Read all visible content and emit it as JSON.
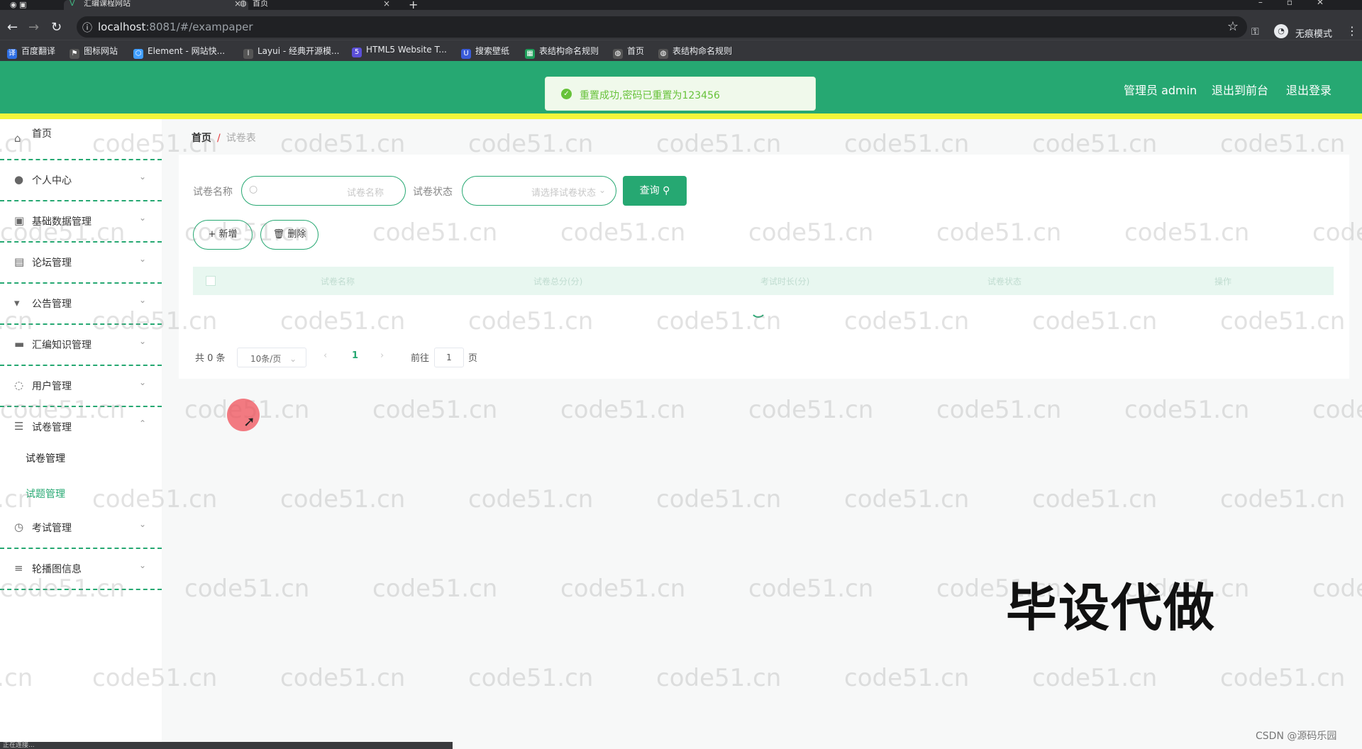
{
  "browser": {
    "tabs": [
      {
        "title": "汇编课程网站",
        "active": true
      },
      {
        "title": "首页",
        "active": false
      }
    ],
    "url_host": "localhost",
    "url_path": ":8081/#/exampaper",
    "incognito_label": "无痕模式",
    "bookmarks": [
      {
        "label": "百度翻译",
        "icon": "baidu-translate-icon",
        "color": "#2f6fe4"
      },
      {
        "label": "图标网站",
        "icon": "flag-icon",
        "color": "#555555"
      },
      {
        "label": "Element - 网站快...",
        "icon": "element-icon",
        "color": "#409eff"
      },
      {
        "label": "Layui - 经典开源模...",
        "icon": "layui-icon",
        "color": "#555555"
      },
      {
        "label": "HTML5 Website T...",
        "icon": "html5-icon",
        "color": "#5b4fd8"
      },
      {
        "label": "搜索壁纸",
        "icon": "wallpaper-icon",
        "color": "#3a5bd9"
      },
      {
        "label": "表结构命名规则",
        "icon": "sheet-icon",
        "color": "#1e9e5a"
      },
      {
        "label": "首页",
        "icon": "globe-icon",
        "color": "#555555"
      },
      {
        "label": "表结构命名规则",
        "icon": "globe-icon",
        "color": "#555555"
      }
    ]
  },
  "header": {
    "admin_label": "管理员 admin",
    "back_to_front": "退出到前台",
    "logout": "退出登录",
    "toast": "重置成功,密码已重置为123456",
    "colors": {
      "primary": "#26a872",
      "stripe": "#f3f53a"
    }
  },
  "sidebar": {
    "items": [
      {
        "label": "首页",
        "icon": "home-icon",
        "has_arrow": false
      },
      {
        "label": "个人中心",
        "icon": "user-icon",
        "has_arrow": true
      },
      {
        "label": "基础数据管理",
        "icon": "data-icon",
        "has_arrow": true
      },
      {
        "label": "论坛管理",
        "icon": "forum-icon",
        "has_arrow": true
      },
      {
        "label": "公告管理",
        "icon": "notice-icon",
        "has_arrow": true
      },
      {
        "label": "汇编知识管理",
        "icon": "knowledge-icon",
        "has_arrow": true
      },
      {
        "label": "用户管理",
        "icon": "users-icon",
        "has_arrow": true
      },
      {
        "label": "试卷管理",
        "icon": "list-icon",
        "has_arrow": true,
        "expanded": true
      }
    ],
    "submenu": [
      {
        "label": "试卷管理",
        "active": true
      },
      {
        "label": "试题管理",
        "active": false
      }
    ],
    "items_after": [
      {
        "label": "考试管理",
        "icon": "clock-icon",
        "has_arrow": true
      },
      {
        "label": "轮播图信息",
        "icon": "sliders-icon",
        "has_arrow": true
      }
    ]
  },
  "breadcrumb": {
    "home": "首页",
    "separator": "/",
    "current": "试卷表"
  },
  "search": {
    "name_label": "试卷名称",
    "name_placeholder": "试卷名称",
    "status_label": "试卷状态",
    "status_placeholder": "请选择试卷状态",
    "query_button": "查询"
  },
  "actions": {
    "add": "+ 新增",
    "delete": "删除"
  },
  "table": {
    "headers": [
      "试卷名称",
      "试卷总分(分)",
      "考试时长(分)",
      "试卷状态",
      "操作"
    ],
    "rows": []
  },
  "pagination": {
    "total_text": "共 0 条",
    "page_size": "10条/页",
    "current_page": "1",
    "goto_label": "前往",
    "goto_value": "1",
    "page_suffix": "页"
  },
  "overlay": {
    "watermark": "code51.cn",
    "promo_text": "毕设代做",
    "credit": "CSDN @源码乐园",
    "status_text": "正在连接..."
  }
}
